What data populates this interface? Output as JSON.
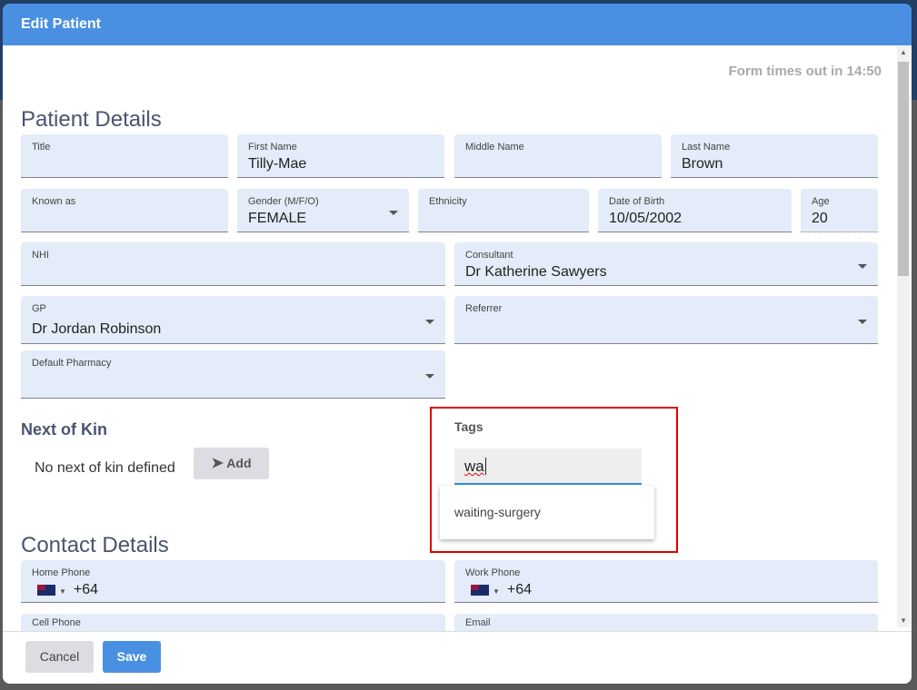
{
  "dialog": {
    "title": "Edit Patient",
    "timeout": "Form times out in 14:50"
  },
  "patient_details": {
    "heading": "Patient Details",
    "title": {
      "label": "Title",
      "value": ""
    },
    "first_name": {
      "label": "First Name",
      "value": "Tilly-Mae"
    },
    "middle_name": {
      "label": "Middle Name",
      "value": ""
    },
    "last_name": {
      "label": "Last Name",
      "value": "Brown"
    },
    "known_as": {
      "label": "Known as",
      "value": ""
    },
    "gender": {
      "label": "Gender (M/F/O)",
      "value": "FEMALE"
    },
    "ethnicity": {
      "label": "Ethnicity",
      "value": ""
    },
    "dob": {
      "label": "Date of Birth",
      "value": "10/05/2002"
    },
    "age": {
      "label": "Age",
      "value": "20"
    },
    "nhi": {
      "label": "NHI",
      "value": ""
    },
    "consultant": {
      "label": "Consultant",
      "value": "Dr Katherine Sawyers"
    },
    "gp": {
      "label": "GP",
      "value": "Dr Jordan Robinson"
    },
    "referrer": {
      "label": "Referrer",
      "value": ""
    },
    "pharmacy": {
      "label": "Default Pharmacy",
      "value": ""
    }
  },
  "next_of_kin": {
    "heading": "Next of Kin",
    "empty": "No next of kin defined",
    "add": "Add"
  },
  "tags": {
    "label": "Tags",
    "value": "wa",
    "suggestions": [
      "waiting-surgery"
    ],
    "highlight_color": "#e00000"
  },
  "contact": {
    "heading": "Contact Details",
    "home_phone": {
      "label": "Home Phone",
      "value": "+64"
    },
    "work_phone": {
      "label": "Work Phone",
      "value": "+64"
    },
    "cell_phone": {
      "label": "Cell Phone"
    },
    "email": {
      "label": "Email"
    }
  },
  "footer": {
    "cancel": "Cancel",
    "save": "Save"
  },
  "colors": {
    "primary": "#4a90e2",
    "field_bg": "#e3ecf8"
  }
}
